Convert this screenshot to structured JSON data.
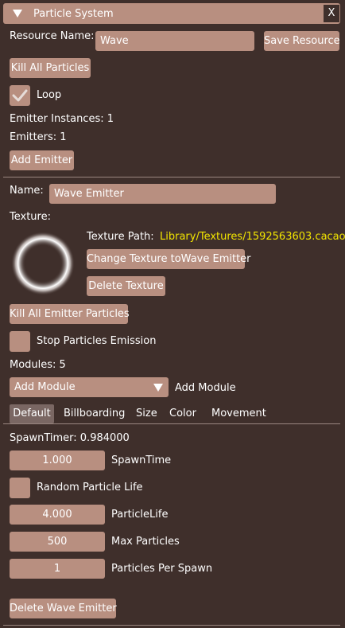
{
  "panel": {
    "title": "Particle System",
    "close_label": "X"
  },
  "resource": {
    "name_label": "Resource Name:",
    "name_value": "Wave",
    "save_label": "Save Resource",
    "kill_all_label": "Kill All Particles",
    "loop_label": "Loop",
    "loop_checked": true,
    "emitter_instances": "Emitter Instances: 1",
    "emitters": "Emitters: 1",
    "add_emitter_label": "Add Emitter"
  },
  "emitter": {
    "name_label": "Name:",
    "name_value": "Wave Emitter",
    "texture_label": "Texture:",
    "texture_path_label": "Texture Path:",
    "texture_path_value": "Library/Textures/1592563603.cacao",
    "change_texture_label": "Change Texture toWave Emitter",
    "delete_texture_label": "Delete Texture",
    "kill_emitter_label": "Kill All Emitter Particles",
    "stop_emission_label": "Stop Particles Emission",
    "modules_count": "Modules: 5",
    "add_module_select": "Add Module",
    "add_module_label": "Add Module",
    "tabs": [
      "Default",
      "Billboarding",
      "Size",
      "Color",
      "Movement"
    ],
    "active_tab": "Default",
    "spawn_timer": "SpawnTimer: 0.984000",
    "spawn_time_value": "1.000",
    "spawn_time_label": "SpawnTime",
    "random_life_label": "Random Particle Life",
    "particle_life_value": "4.000",
    "particle_life_label": "ParticleLife",
    "max_particles_value": "500",
    "max_particles_label": "Max Particles",
    "per_spawn_value": "1",
    "per_spawn_label": "Particles Per Spawn",
    "delete_emitter_label": "Delete Wave Emitter"
  }
}
